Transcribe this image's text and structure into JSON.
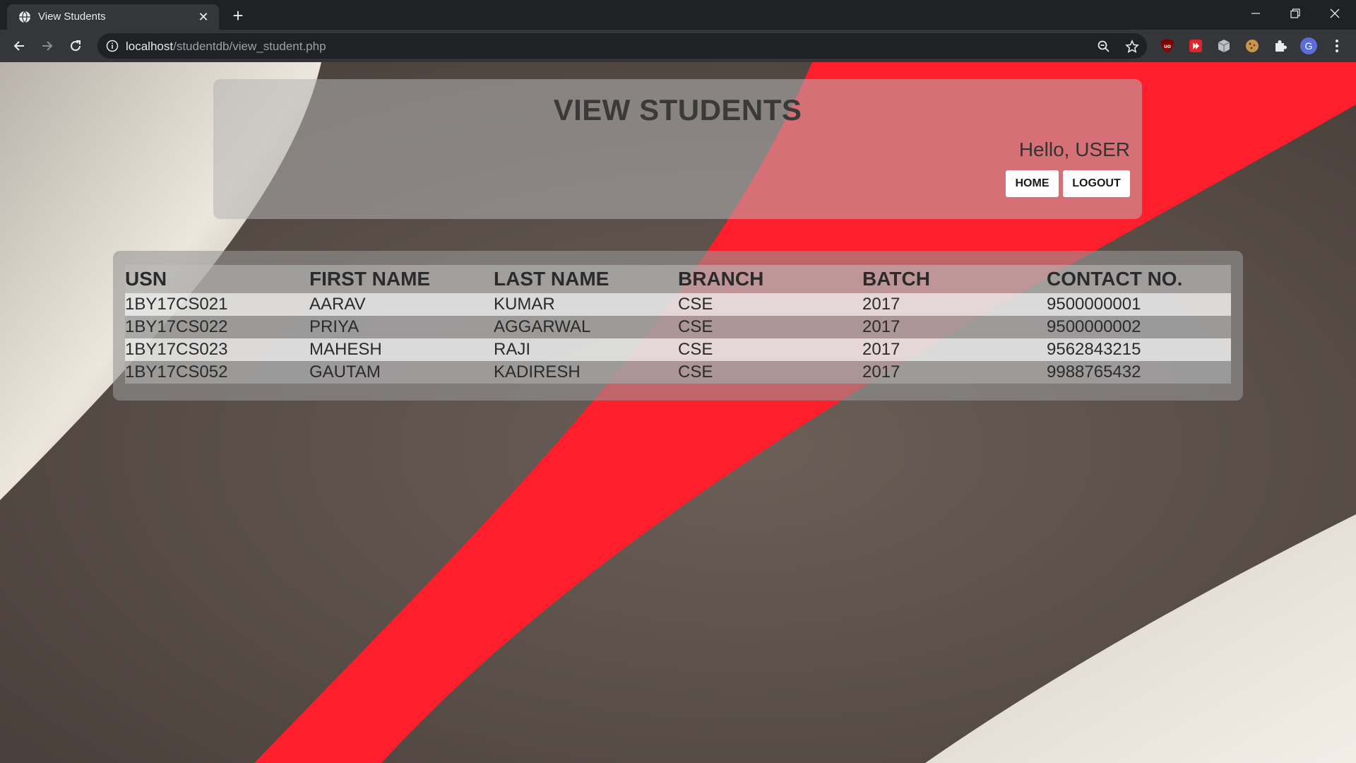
{
  "browser": {
    "tab_title": "View Students",
    "url_host": "localhost",
    "url_path": "/studentdb/view_student.php",
    "profile_initial": "G"
  },
  "page": {
    "title": "VIEW STUDENTS",
    "greeting": "Hello, USER",
    "home_label": "HOME",
    "logout_label": "LOGOUT"
  },
  "table": {
    "headers": [
      "USN",
      "FIRST NAME",
      "LAST NAME",
      "BRANCH",
      "BATCH",
      "CONTACT NO."
    ],
    "rows": [
      [
        "1BY17CS021",
        "AARAV",
        "KUMAR",
        "CSE",
        "2017",
        "9500000001"
      ],
      [
        "1BY17CS022",
        "PRIYA",
        "AGGARWAL",
        "CSE",
        "2017",
        "9500000002"
      ],
      [
        "1BY17CS023",
        "MAHESH",
        "RAJI",
        "CSE",
        "2017",
        "9562843215"
      ],
      [
        "1BY17CS052",
        "GAUTAM",
        "KADIRESH",
        "CSE",
        "2017",
        "9988765432"
      ]
    ]
  },
  "colors": {
    "chrome_dark": "#202124",
    "chrome_toolbar": "#35363a",
    "background_red": "#fe1e2c",
    "background_dark": "#5d524c",
    "background_light": "#e9e3da"
  },
  "icons": {
    "favicon": "globe-icon",
    "extensions": [
      "ublock-icon",
      "red-extension-icon",
      "cube-extension-icon",
      "cookie-icon",
      "puzzle-icon"
    ]
  }
}
